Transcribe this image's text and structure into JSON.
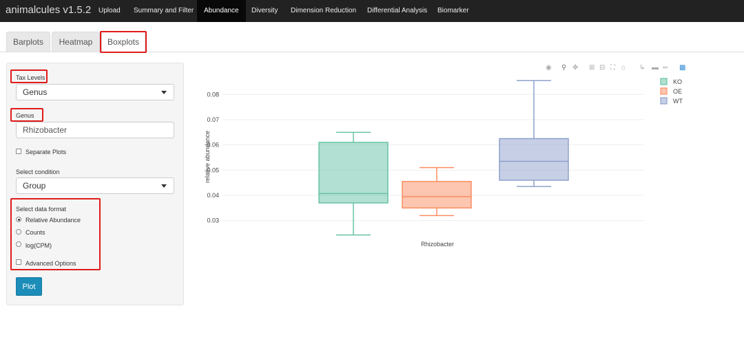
{
  "app": {
    "brand": "animalcules v1.5.2"
  },
  "nav": [
    "Upload",
    "Summary and Filter",
    "Abundance",
    "Diversity",
    "Dimension Reduction",
    "Differential Analysis",
    "Biomarker"
  ],
  "tabs": [
    "Barplots",
    "Heatmap",
    "Boxplots"
  ],
  "sidebar": {
    "tax_levels_label": "Tax Levels",
    "tax_levels_value": "Genus",
    "genus_label": "Genus",
    "genus_value": "Rhizobacter",
    "separate_plots_label": "Separate Plots",
    "condition_label": "Select condition",
    "condition_value": "Group",
    "format_label": "Select data format",
    "formats": [
      "Relative Abundance",
      "Counts",
      "log(CPM)"
    ],
    "selected_format": "Relative Abundance",
    "advanced_label": "Advanced Options",
    "plot_button": "Plot"
  },
  "colors": {
    "KO": "#66c2a5",
    "OE": "#fc8d62",
    "WT": "#8da0cb",
    "accent": "#1b8db8",
    "highlight": "#e01a1a"
  },
  "chart_data": {
    "type": "box",
    "xlabel": "Rhizobacter",
    "ylabel": "relative abundance",
    "ylim": [
      0.022,
      0.088
    ],
    "yticks": [
      0.03,
      0.04,
      0.05,
      0.06,
      0.07,
      0.08
    ],
    "legend_position": "top-right",
    "series": [
      {
        "name": "KO",
        "min": 0.0243,
        "q1": 0.037,
        "median": 0.0407,
        "q3": 0.061,
        "max": 0.065
      },
      {
        "name": "OE",
        "min": 0.032,
        "q1": 0.035,
        "median": 0.0395,
        "q3": 0.0455,
        "max": 0.051
      },
      {
        "name": "WT",
        "min": 0.0435,
        "q1": 0.046,
        "median": 0.0535,
        "q3": 0.0625,
        "max": 0.0855
      }
    ]
  }
}
